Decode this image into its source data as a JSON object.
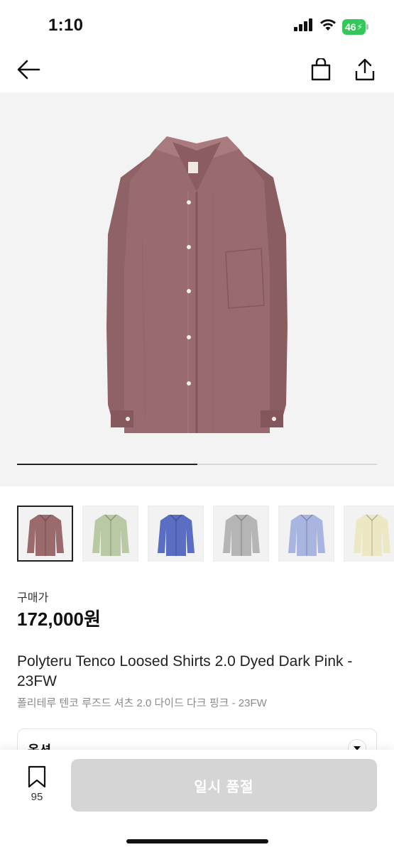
{
  "status_bar": {
    "time": "1:10",
    "battery": "46"
  },
  "nav": {
    "back_icon": "arrow-left-icon",
    "bag_icon": "shopping-bag-icon",
    "share_icon": "share-icon"
  },
  "gallery": {
    "progress": 0.5,
    "thumbnails": [
      {
        "color": "#9a6a6c",
        "selected": true
      },
      {
        "color": "#b8c9a4",
        "selected": false
      },
      {
        "color": "#5a6ec4",
        "selected": false
      },
      {
        "color": "#b5b5b5",
        "selected": false
      },
      {
        "color": "#a9b4e0",
        "selected": false
      },
      {
        "color": "#ece8c4",
        "selected": false
      }
    ]
  },
  "product": {
    "price_label": "구매가",
    "price": "172,000원",
    "title_en": "Polyteru Tenco Loosed Shirts 2.0 Dyed Dark Pink - 23FW",
    "title_ko": "폴리테루 텐코 루즈드 셔츠 2.0 다이드 다크 핑크 - 23FW"
  },
  "option": {
    "label": "옵션"
  },
  "bottom": {
    "bookmark_count": "95",
    "cta_label": "일시 품절"
  },
  "colors": {
    "shirt": "#9a6b6e",
    "cta_disabled": "#d5d5d5",
    "battery": "#34c759"
  }
}
